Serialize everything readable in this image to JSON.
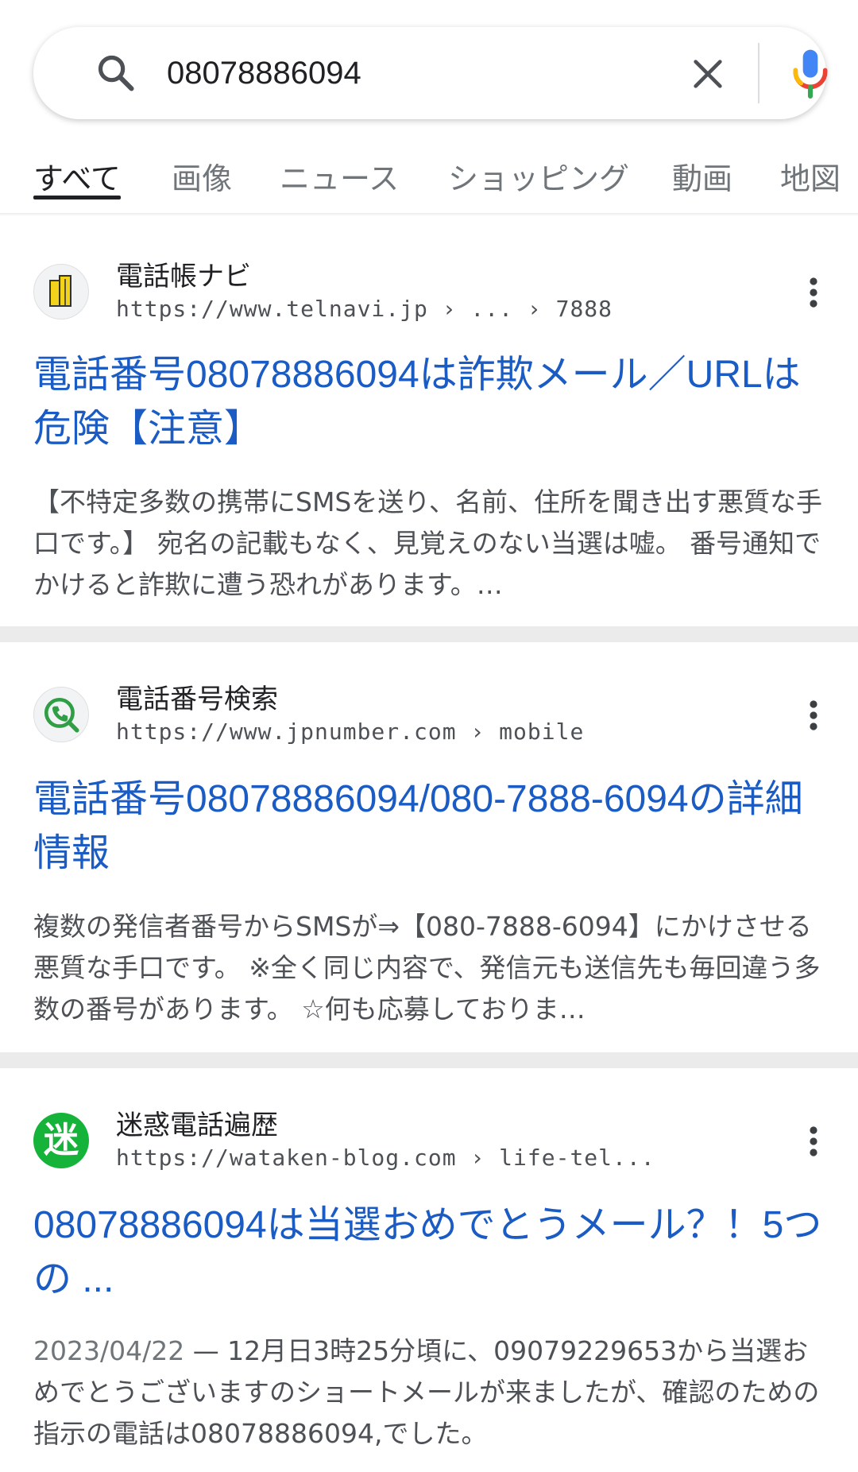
{
  "search": {
    "query": "08078886094"
  },
  "tabs": [
    {
      "label": "すべて",
      "active": true
    },
    {
      "label": "画像"
    },
    {
      "label": "ニュース"
    },
    {
      "label": "ショッピング"
    },
    {
      "label": "動画"
    },
    {
      "label": "地図"
    }
  ],
  "results": [
    {
      "site_name": "電話帳ナビ",
      "url": "https://www.telnavi.jp › ... › 7888",
      "title": "電話番号08078886094は詐欺メール／URLは危険【注意】",
      "snippet": "【不特定多数の携帯にSMSを送り、名前、住所を聞き出す悪質な手口です。】 宛名の記載もなく、見覚えのない当選は嘘。 番号通知でかけると詐欺に遭う恐れがあります。…"
    },
    {
      "site_name": "電話番号検索",
      "url": "https://www.jpnumber.com › mobile",
      "title": "電話番号08078886094/080-7888-6094の詳細情報",
      "snippet": "複数の発信者番号からSMSが⇒【080-7888-6094】にかけさせる悪質な手口です。 ※全く同じ内容で、発信元も送信先も毎回違う多数の番号があります。 ☆何も応募しておりま…"
    },
    {
      "site_name": "迷惑電話遍歴",
      "url": "https://wataken-blog.com › life-tel...",
      "title": "08078886094は当選おめでとうメール？！5つの ...",
      "date": "2023/04/22",
      "snippet": " — 12月日3時25分頃に、09079229653から当選おめでとうございますのショートメールが来ましたが、確認のための指示の電話は08078886094,でした。",
      "favicon_text": "迷"
    }
  ],
  "colors": {
    "link": "#1a5bc4",
    "favicon3_bg": "#16b33a"
  }
}
